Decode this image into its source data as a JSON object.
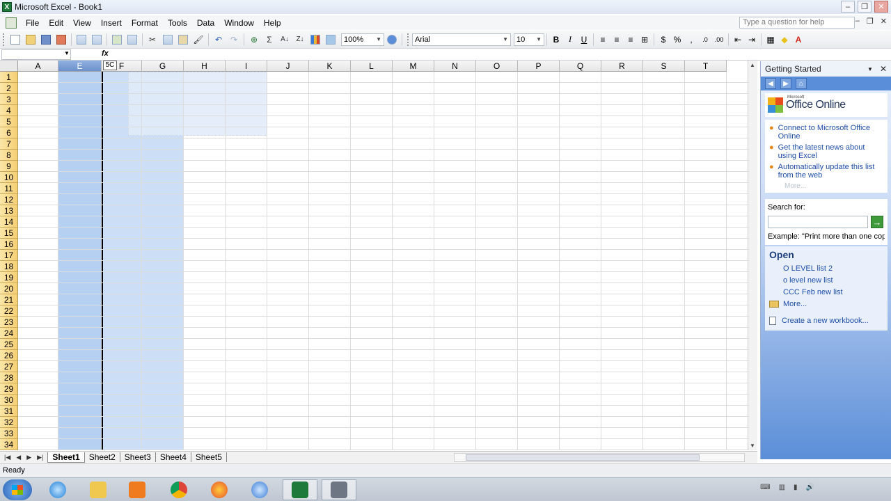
{
  "window": {
    "title": "Microsoft Excel - Book1",
    "app_icon": "excel-icon"
  },
  "menu": {
    "items": [
      "File",
      "Edit",
      "View",
      "Insert",
      "Format",
      "Tools",
      "Data",
      "Window",
      "Help"
    ],
    "help_placeholder": "Type a question for help"
  },
  "toolbar": {
    "zoom": "100%",
    "font_name": "Arial",
    "font_size": "10",
    "bold": "B",
    "italic": "I",
    "underline": "U",
    "currency": "$",
    "percent": "%"
  },
  "formula_bar": {
    "name_box": "",
    "fx": "fx",
    "drag_hint": "5C"
  },
  "grid": {
    "columns": [
      "A",
      "E",
      "F",
      "G",
      "H",
      "I",
      "J",
      "K",
      "L",
      "M",
      "N",
      "O",
      "P",
      "Q",
      "R",
      "S",
      "T"
    ],
    "selected_columns": [
      "E"
    ],
    "rows": [
      "1",
      "2",
      "3",
      "4",
      "5",
      "6",
      "7",
      "8",
      "9",
      "10",
      "11",
      "12",
      "13",
      "14",
      "15",
      "16",
      "17",
      "18",
      "19",
      "20",
      "21",
      "22",
      "23",
      "24",
      "25",
      "26",
      "27",
      "28",
      "29",
      "30",
      "31",
      "32",
      "33",
      "34"
    ]
  },
  "sheets": {
    "tabs": [
      "Sheet1",
      "Sheet2",
      "Sheet3",
      "Sheet4",
      "Sheet5"
    ],
    "active": "Sheet1"
  },
  "status": {
    "text": "Ready"
  },
  "task_pane": {
    "title": "Getting Started",
    "office_online_small": "Microsoft",
    "office_online": "Office Online",
    "links": [
      "Connect to Microsoft Office Online",
      "Get the latest news about using Excel",
      "Automatically update this list from the web"
    ],
    "more_dim": "More...",
    "search_label": "Search for:",
    "example": "Example:  \"Print more than one copy\"",
    "open_title": "Open",
    "recent_files": [
      "O LEVEL list 2",
      "o level new list",
      "CCC Feb new list"
    ],
    "more": "More...",
    "new_workbook": "Create a new workbook..."
  },
  "colors": {
    "selection": "#78aae6",
    "row_header": "#f5cf73",
    "task_pane_blue": "#5b8ed8",
    "link": "#1f4ea8"
  }
}
